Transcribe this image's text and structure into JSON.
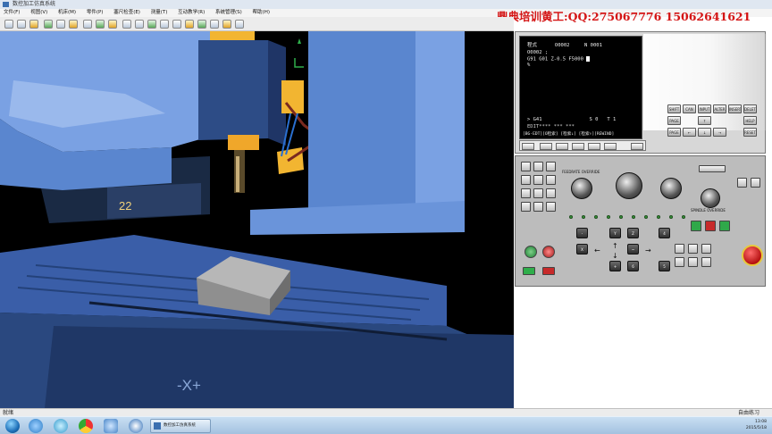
{
  "window": {
    "title": "数控加工仿真系统"
  },
  "menu": {
    "items": [
      "文件(F)",
      "视图(V)",
      "机床(M)",
      "零件(P)",
      "塞尺检查(E)",
      "测量(T)",
      "互动教学(R)",
      "系统管理(S)",
      "帮助(H)"
    ]
  },
  "banner": {
    "text": "鼎典培训黄工:QQ:275067776  15062641621"
  },
  "machine": {
    "axis_label": "-X+",
    "tool_number": "22"
  },
  "cnc_screen": {
    "header_mode": "程式",
    "header_prog": "O0002",
    "header_n": "N 0001",
    "lines": [
      "O0002 ;",
      "G91 G01 Z-0.5 F5000 ",
      "%"
    ],
    "input_prompt": "> G41",
    "status_s": "S 0",
    "status_t": "T 1",
    "status_mode": "EDIT**** *** ***",
    "softkey_row": "[BG-EDT][O检索] [检索↓] [检索↑][REWIND]"
  },
  "keypad": {
    "row1": [
      "SHIFT",
      "CAN",
      "INPUT"
    ],
    "row1b": [
      "ALTER",
      "INSERT",
      "DELETE"
    ],
    "row2": [
      "↑",
      "HELP"
    ],
    "row3": [
      "←",
      "↓",
      "→",
      "RESET"
    ],
    "page_up": "PAGE ↑",
    "page_down": "PAGE ↓"
  },
  "operator_panel": {
    "feed_rate": "FEEDRATE OVERRIDE",
    "spindle": "SPINDLE OVERRIDE",
    "jog_keys": [
      "X",
      "Y",
      "Z",
      "4",
      "5",
      "6"
    ],
    "jog_dir": [
      "+",
      "-"
    ],
    "rapid": "~",
    "arrow_left": "←",
    "arrow_right": "→",
    "arrow_up": "↑",
    "arrow_down": "↓"
  },
  "statusbar": {
    "left": "就绪",
    "right": "自由练习"
  },
  "taskbar": {
    "app": "数控加工仿真系统",
    "time": "13:08",
    "date": "2015/5/18"
  },
  "colors": {
    "machine_blue": "#7aa1e3",
    "machine_dark": "#2e4c7e",
    "accent_red": "#d41414"
  }
}
